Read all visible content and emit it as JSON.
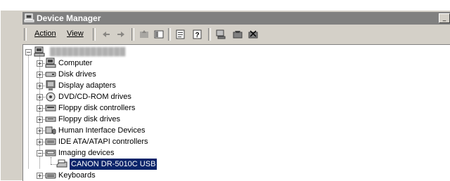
{
  "window": {
    "title": "Device Manager"
  },
  "menu": {
    "action": "Action",
    "view": "View"
  },
  "toolbar_icons": [
    "back-icon",
    "forward-icon",
    "up-icon",
    "console-tree-icon",
    "properties-icon",
    "help-icon",
    "scan-hardware-icon",
    "update-driver-icon",
    "uninstall-icon"
  ],
  "tree": {
    "root": "",
    "items": [
      {
        "label": "Computer",
        "icon": "computer-icon"
      },
      {
        "label": "Disk drives",
        "icon": "disk-drive-icon"
      },
      {
        "label": "Display adapters",
        "icon": "display-adapter-icon"
      },
      {
        "label": "DVD/CD-ROM drives",
        "icon": "cdrom-icon"
      },
      {
        "label": "Floppy disk controllers",
        "icon": "floppy-controller-icon"
      },
      {
        "label": "Floppy disk drives",
        "icon": "floppy-drive-icon"
      },
      {
        "label": "Human Interface Devices",
        "icon": "hid-icon"
      },
      {
        "label": "IDE ATA/ATAPI controllers",
        "icon": "ide-controller-icon"
      },
      {
        "label": "Imaging devices",
        "icon": "imaging-device-icon",
        "expanded": true
      },
      {
        "label": "CANON DR-5010C USB",
        "icon": "scanner-icon",
        "selected": true,
        "child": true
      },
      {
        "label": "Keyboards",
        "icon": "keyboard-icon"
      }
    ]
  }
}
